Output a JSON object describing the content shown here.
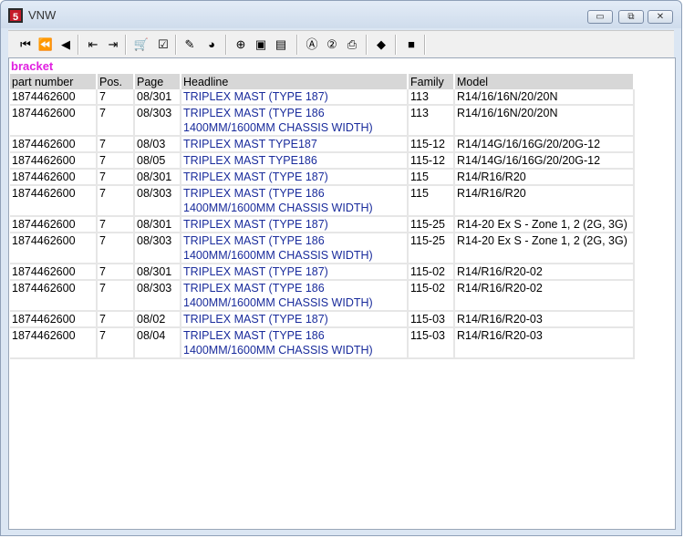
{
  "window": {
    "title": "VNW",
    "icon": "app-logo-icon"
  },
  "window_buttons": [
    {
      "name": "minimize",
      "glyph": "▭"
    },
    {
      "name": "maximize",
      "glyph": "⧉"
    },
    {
      "name": "close",
      "glyph": "✕"
    }
  ],
  "toolbar": [
    {
      "name": "first-icon",
      "glyph": "⏮"
    },
    {
      "name": "rewind-icon",
      "glyph": "⏪"
    },
    {
      "name": "previous-icon",
      "glyph": "◀"
    },
    {
      "name": "back-page-icon",
      "glyph": "⇤"
    },
    {
      "name": "forward-page-icon",
      "glyph": "⇥"
    },
    {
      "name": "cart-icon",
      "glyph": "🛒"
    },
    {
      "name": "checklist-icon",
      "glyph": "☑"
    },
    {
      "name": "pen-icon",
      "glyph": "✎"
    },
    {
      "name": "globe-icon",
      "glyph": "◕"
    },
    {
      "name": "zoom-icon",
      "glyph": "⊕"
    },
    {
      "name": "page-icon",
      "glyph": "▣"
    },
    {
      "name": "page-2-icon",
      "glyph": "▤"
    },
    {
      "name": "a-circle-icon",
      "glyph": "Ⓐ"
    },
    {
      "name": "two-circle-icon",
      "glyph": "②"
    },
    {
      "name": "printer-icon",
      "glyph": "⎙"
    },
    {
      "name": "eraser-icon",
      "glyph": "◆"
    },
    {
      "name": "stop-icon",
      "glyph": "■"
    }
  ],
  "content": {
    "heading": "bracket",
    "columns": [
      "part number",
      "Pos.",
      "Page",
      "Headline",
      "Family",
      "Model"
    ],
    "rows": [
      {
        "part": "1874462600",
        "pos": "7",
        "page": "08/301",
        "headline": "TRIPLEX MAST (TYPE 187)",
        "headline2": "",
        "family": "113",
        "model": "R14/16/16N/20/20N"
      },
      {
        "part": "1874462600",
        "pos": "7",
        "page": "08/303",
        "headline": "TRIPLEX MAST (TYPE 186",
        "headline2": "1400MM/1600MM CHASSIS WIDTH)",
        "family": "113",
        "model": "R14/16/16N/20/20N"
      },
      {
        "part": "1874462600",
        "pos": "7",
        "page": "08/03",
        "headline": "TRIPLEX MAST TYPE187",
        "headline2": "",
        "family": "115-12",
        "model": "R14/14G/16/16G/20/20G-12"
      },
      {
        "part": "1874462600",
        "pos": "7",
        "page": "08/05",
        "headline": "TRIPLEX MAST TYPE186",
        "headline2": "",
        "family": "115-12",
        "model": "R14/14G/16/16G/20/20G-12"
      },
      {
        "part": "1874462600",
        "pos": "7",
        "page": "08/301",
        "headline": "TRIPLEX MAST (TYPE 187)",
        "headline2": "",
        "family": "115",
        "model": "R14/R16/R20"
      },
      {
        "part": "1874462600",
        "pos": "7",
        "page": "08/303",
        "headline": "TRIPLEX MAST (TYPE 186",
        "headline2": "1400MM/1600MM CHASSIS WIDTH)",
        "family": "115",
        "model": "R14/R16/R20"
      },
      {
        "part": "1874462600",
        "pos": "7",
        "page": "08/301",
        "headline": "TRIPLEX MAST (TYPE 187)",
        "headline2": "",
        "family": "115-25",
        "model": "R14-20 Ex S - Zone 1, 2 (2G, 3G)"
      },
      {
        "part": "1874462600",
        "pos": "7",
        "page": "08/303",
        "headline": "TRIPLEX MAST (TYPE 186",
        "headline2": "1400MM/1600MM CHASSIS WIDTH)",
        "family": "115-25",
        "model": "R14-20 Ex S - Zone 1, 2 (2G, 3G)"
      },
      {
        "part": "1874462600",
        "pos": "7",
        "page": "08/301",
        "headline": "TRIPLEX MAST (TYPE 187)",
        "headline2": "",
        "family": "115-02",
        "model": "R14/R16/R20-02"
      },
      {
        "part": "1874462600",
        "pos": "7",
        "page": "08/303",
        "headline": "TRIPLEX MAST (TYPE 186",
        "headline2": "1400MM/1600MM CHASSIS WIDTH)",
        "family": "115-02",
        "model": "R14/R16/R20-02"
      },
      {
        "part": "1874462600",
        "pos": "7",
        "page": "08/02",
        "headline": "TRIPLEX MAST (TYPE 187)",
        "headline2": "",
        "family": "115-03",
        "model": "R14/R16/R20-03"
      },
      {
        "part": "1874462600",
        "pos": "7",
        "page": "08/04",
        "headline": "TRIPLEX MAST (TYPE 186",
        "headline2": "1400MM/1600MM CHASSIS WIDTH)",
        "family": "115-03",
        "model": "R14/R16/R20-03"
      }
    ]
  }
}
